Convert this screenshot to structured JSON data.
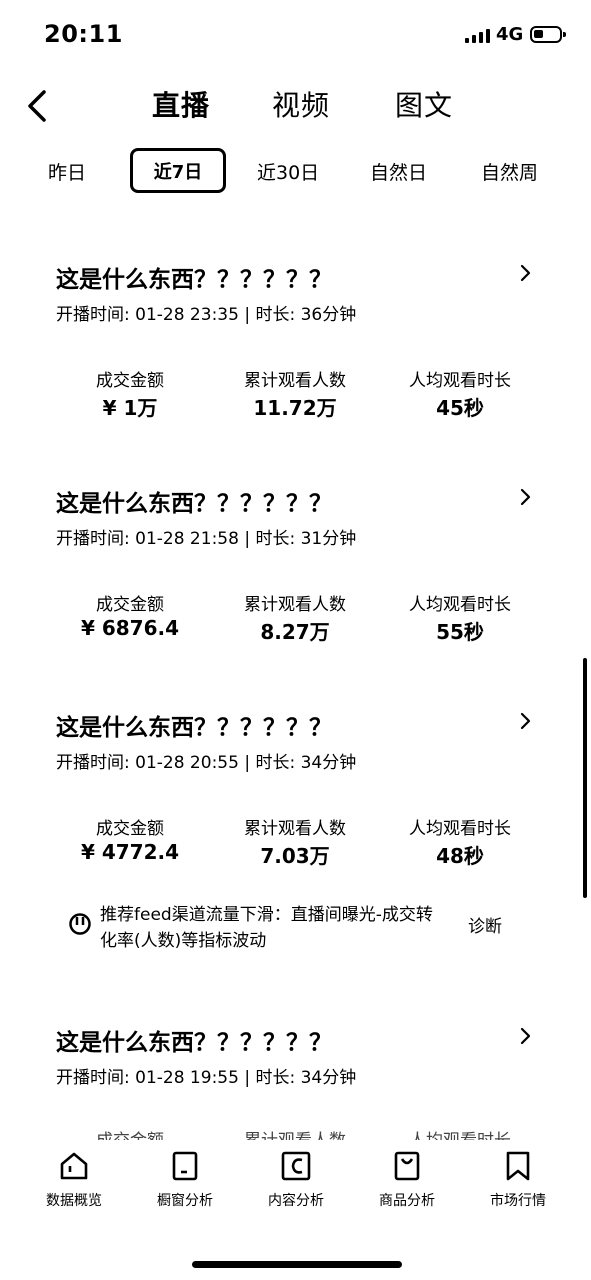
{
  "status_bar": {
    "time": "20:11",
    "network": "4G"
  },
  "top_tabs": [
    "直播",
    "视频",
    "图文"
  ],
  "range_tabs": [
    "昨日",
    "近7日",
    "近30日",
    "自然日",
    "自然周"
  ],
  "cards": [
    {
      "title": "这是什么东西？？？？？？",
      "meta": "开播时间: 01-28 23:35 | 时长: 36分钟",
      "metrics": [
        {
          "label": "成交金额",
          "value": "¥ 1万"
        },
        {
          "label": "累计观看人数",
          "value": "11.72万"
        },
        {
          "label": "人均观看时长",
          "value": "45秒"
        }
      ]
    },
    {
      "title": "这是什么东西？？？？？？",
      "meta": "开播时间: 01-28 21:58 | 时长: 31分钟",
      "metrics": [
        {
          "label": "成交金额",
          "value": "¥ 6876.4"
        },
        {
          "label": "累计观看人数",
          "value": "8.27万"
        },
        {
          "label": "人均观看时长",
          "value": "55秒"
        }
      ]
    },
    {
      "title": "这是什么东西？？？？？？",
      "meta": "开播时间: 01-28 20:55 | 时长: 34分钟",
      "metrics": [
        {
          "label": "成交金额",
          "value": "¥ 4772.4"
        },
        {
          "label": "累计观看人数",
          "value": "7.03万"
        },
        {
          "label": "人均观看时长",
          "value": "48秒"
        }
      ]
    },
    {
      "title": "这是什么东西？？？？？？",
      "meta": "开播时间: 01-28 19:55 | 时长: 34分钟",
      "metrics": [
        {
          "label": "成交金额"
        },
        {
          "label": "累计观看人数"
        },
        {
          "label": "人均观看时长"
        }
      ]
    }
  ],
  "tip": {
    "text": "推荐feed渠道流量下滑：直播间曝光-成交转化率(人数)等指标波动",
    "action": "诊断"
  },
  "bottom_nav": [
    "数据概览",
    "橱窗分析",
    "内容分析",
    "商品分析",
    "市场行情"
  ]
}
